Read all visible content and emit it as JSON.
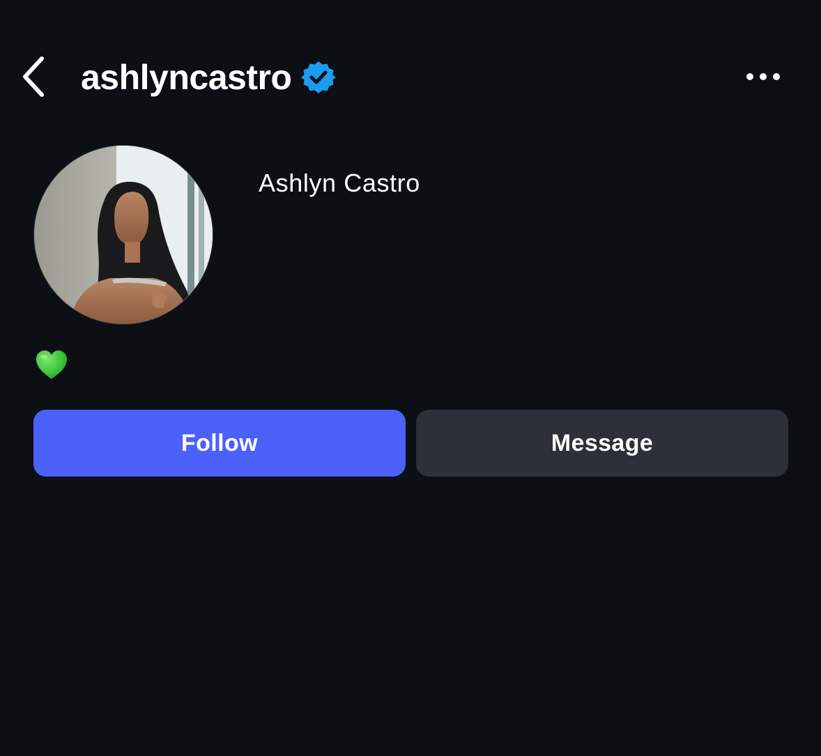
{
  "header": {
    "username": "ashlyncastro",
    "verified": true,
    "back_icon": "chevron-left-icon",
    "more_icon": "ellipsis-icon"
  },
  "profile": {
    "display_name": "Ashlyn Castro",
    "bio_emoji": "green-heart"
  },
  "actions": {
    "follow_label": "Follow",
    "message_label": "Message"
  },
  "colors": {
    "background": "#0c0f14",
    "follow_button": "#4b61fa",
    "message_button": "#2c3039",
    "verified_badge": "#1d9bf0",
    "heart": "#3ec63a"
  }
}
